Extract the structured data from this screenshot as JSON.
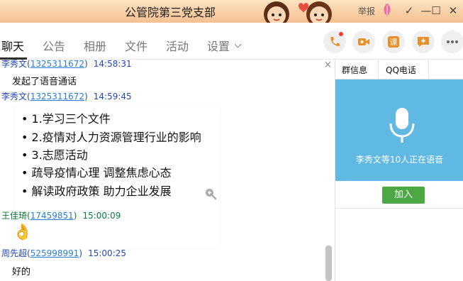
{
  "window": {
    "title": "公管院第三党支部",
    "report_label": "举报",
    "minimize_glyph": "—",
    "maximize_glyph": "☐",
    "close_glyph": "✕",
    "dropdown_glyph": "✓"
  },
  "tabs": [
    {
      "label": "聊天",
      "active": true
    },
    {
      "label": "公告"
    },
    {
      "label": "相册"
    },
    {
      "label": "文件"
    },
    {
      "label": "活动"
    },
    {
      "label": "设置"
    }
  ],
  "toolbar": {
    "icons": [
      "phone-icon",
      "video-call-icon",
      "course-icon",
      "add-message-icon",
      "more-icon"
    ],
    "course_label": "课",
    "accent": "#e8902a"
  },
  "messages": [
    {
      "sender": "李秀文",
      "qq": "1325311672",
      "time": "14:58:31",
      "text": "发起了语音通话"
    },
    {
      "sender": "李秀文",
      "qq": "1325311672",
      "time": "14:59:45",
      "bullets": [
        "• 1.学习三个文件",
        "• 2.疫情对人力资源管理行业的影响",
        "• 3.志愿活动",
        "• 疏导疫情心理  调整焦虑心态",
        "• 解读政府政策  助力企业发展"
      ]
    },
    {
      "sender": "王佳琦",
      "qq": "17459851",
      "time": "15:00:09",
      "emoji": "👌"
    },
    {
      "sender": "周先超",
      "qq": "525998991",
      "time": "15:00:25",
      "text": "好的"
    }
  ],
  "right_panel": {
    "tabs": [
      "群信息",
      "QQ电话"
    ],
    "voice_status": "李秀文等10人正在语音",
    "join_label": "加入",
    "voice_bg": "#5fb9e3",
    "join_bg": "#4ca843"
  },
  "chat": {
    "close_glyph": "×"
  }
}
